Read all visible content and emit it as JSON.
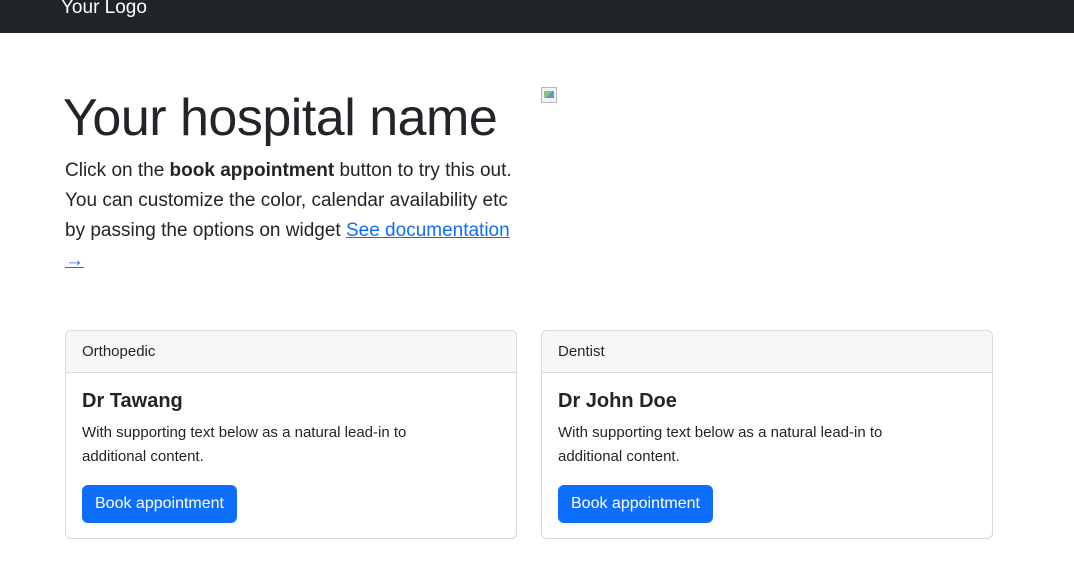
{
  "navbar": {
    "brand": "Your Logo"
  },
  "hero": {
    "title": "Your hospital name",
    "lead_before": "Click on the ",
    "lead_bold": "book appointment",
    "lead_after": " button to try this out. You can customize the color, calendar availability etc by passing the options on widget ",
    "link": "See documentation →",
    "image_icon": "broken-image-icon"
  },
  "cards": [
    {
      "header": "Orthopedic",
      "title": "Dr Tawang",
      "text": "With supporting text below as a natural lead-in to additional content.",
      "button": "Book appointment"
    },
    {
      "header": "Dentist",
      "title": "Dr John Doe",
      "text": "With supporting text below as a natural lead-in to additional content.",
      "button": "Book appointment"
    }
  ],
  "colors": {
    "navbar": "#212529",
    "link": "#0d6efd",
    "button": "#0d6efd",
    "card_header": "#f7f7f7",
    "card_border": "#d7d9db"
  }
}
